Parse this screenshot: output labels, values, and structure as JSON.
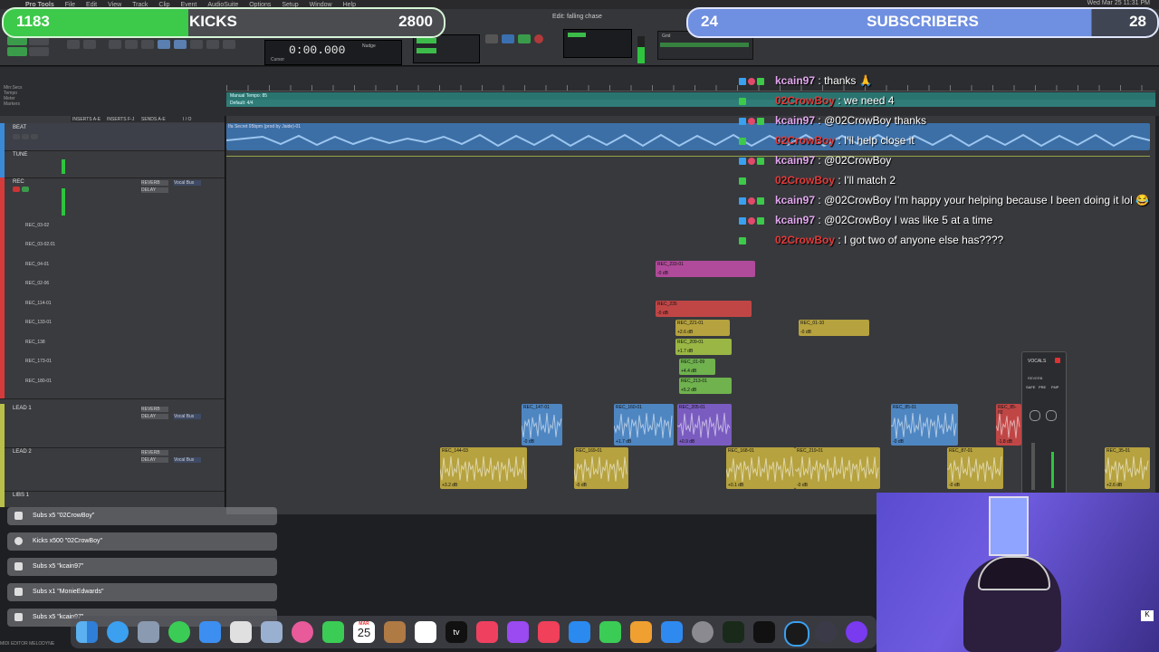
{
  "menubar": {
    "apple": "",
    "items": [
      "Pro Tools",
      "File",
      "Edit",
      "View",
      "Track",
      "Clip",
      "Event",
      "AudioSuite",
      "Options",
      "Setup",
      "Window",
      "Help"
    ],
    "clock": "Wed Mar 25  11:31 PM"
  },
  "overlay": {
    "kicks": {
      "left": "1183",
      "center": "KICKS",
      "right": "2800",
      "progress": 0.42
    },
    "subs": {
      "left": "24",
      "center": "SUBSCRIBERS",
      "right": "28",
      "progress": 0.86
    }
  },
  "toolbar": {
    "counter_main": "0:00.000",
    "edit_title": "Edit: falling chase",
    "cursor_label": "Cursor",
    "grid_label": "Grid",
    "nudge_label": "Nudge"
  },
  "ruler": {
    "labels": [
      "Min:Secs",
      "Tempo",
      "Meter",
      "Markers"
    ],
    "tempo_text": "Manual Tempo: 85",
    "meter_text": "Default: 4/4"
  },
  "track_headers": [
    "INSERTS A-E",
    "INSERTS F-J",
    "SENDS A-E",
    "I / O"
  ],
  "tracks": [
    {
      "name": "BEAT",
      "color": "#3b8ad6"
    },
    {
      "name": "TUNE",
      "color": "#3b8ad6"
    },
    {
      "name": "REC",
      "color": "#d63b3b"
    },
    {
      "name": "LEAD 1",
      "color": "#b8c04a"
    },
    {
      "name": "LEAD 2",
      "color": "#b8c04a"
    },
    {
      "name": "LIBS 1",
      "color": "#b8c04a"
    }
  ],
  "rec_subtracks": [
    "REC_03-02",
    "REC_03-02.01",
    "REC_04-01",
    "REC_02-06",
    "REC_114-01",
    "REC_133-01",
    "REC_138",
    "REC_173-01",
    "REC_180-01"
  ],
  "inserts": {
    "reverb": "REVERB",
    "delay": "DELAY",
    "vocal_bus": "Vocal Bus"
  },
  "clips": [
    {
      "name": "REC_233-01",
      "gain": "-0 dB",
      "color": "#b04a9a"
    },
    {
      "name": "REC_235",
      "gain": "-0 dB",
      "color": "#c04646"
    },
    {
      "name": "REC_221-01",
      "gain": "+2.6 dB",
      "color": "#b6a23e"
    },
    {
      "name": "REC_01-10",
      "gain": "-0 dB",
      "color": "#b6a23e"
    },
    {
      "name": "REC_209-01",
      "gain": "+1.7 dB",
      "color": "#9ab644"
    },
    {
      "name": "REC_01-09",
      "gain": "+4.4 dB",
      "color": "#6fb24e"
    },
    {
      "name": "REC_213-01",
      "gain": "+5.2 dB",
      "color": "#6fb24e"
    },
    {
      "name": "REC_147-01",
      "gain": "-0 dB",
      "color": "#4e86c2"
    },
    {
      "name": "REC_160-01",
      "gain": "+1.7 dB",
      "color": "#4e86c2"
    },
    {
      "name": "REC_205-01",
      "gain": "+0.9 dB",
      "color": "#7a5cc0"
    },
    {
      "name": "REC_85-01",
      "gain": "-0 dB",
      "color": "#4e86c2"
    },
    {
      "name": "REC_85-02",
      "gain": "-1.8 dB",
      "color": "#c04646"
    },
    {
      "name": "REC_144-03",
      "gain": "+3.2 dB",
      "color": "#b6a23e"
    },
    {
      "name": "REC_169-01",
      "gain": "-0 dB",
      "color": "#b6a23e"
    },
    {
      "name": "REC_168-01",
      "gain": "+0.1 dB",
      "color": "#b6a23e"
    },
    {
      "name": "REC_219-01",
      "gain": "-0 dB",
      "color": "#b6a23e"
    },
    {
      "name": "REC_87-01",
      "gain": "-0 dB",
      "color": "#b6a23e"
    },
    {
      "name": "REC_35-01",
      "gain": "+2.6 dB",
      "color": "#b6a23e"
    }
  ],
  "beat_clip_name": "Ifa Secret 95bpm (prod by Jaide)-01",
  "chat": [
    {
      "user": "kcain97",
      "user_color": "#e3a8f0",
      "badges": [
        "sub",
        "heart",
        "star"
      ],
      "msg": "thanks 🙏"
    },
    {
      "user": "02CrowBoy",
      "user_color": "#e23b3b",
      "badges": [
        "star"
      ],
      "msg": "we need 4"
    },
    {
      "user": "kcain97",
      "user_color": "#e3a8f0",
      "badges": [
        "sub",
        "heart",
        "star"
      ],
      "msg": "@02CrowBoy thanks"
    },
    {
      "user": "02CrowBoy",
      "user_color": "#e23b3b",
      "badges": [
        "star"
      ],
      "msg": "I'll help close it"
    },
    {
      "user": "kcain97",
      "user_color": "#e3a8f0",
      "badges": [
        "sub",
        "heart",
        "star"
      ],
      "msg": "@02CrowBoy"
    },
    {
      "user": "02CrowBoy",
      "user_color": "#e23b3b",
      "badges": [
        "star"
      ],
      "msg": "I'll match 2"
    },
    {
      "user": "kcain97",
      "user_color": "#e3a8f0",
      "badges": [
        "sub",
        "heart",
        "star"
      ],
      "msg": "@02CrowBoy I'm happy your helping because I been doing it lol 😂"
    },
    {
      "user": "kcain97",
      "user_color": "#e3a8f0",
      "badges": [
        "sub",
        "heart",
        "star"
      ],
      "msg": "@02CrowBoy I was like 5 at a time"
    },
    {
      "user": "02CrowBoy",
      "user_color": "#e23b3b",
      "badges": [
        "star"
      ],
      "msg": "I got two of anyone else has????"
    }
  ],
  "alerts": [
    "Subs x5 \"02CrowBoy\"",
    "Kicks x500 \"02CrowBoy\"",
    "Subs x5 \"kcain97\"",
    "Subs x1 \"MonieEdwards\"",
    "Subs x5 \"kcain97\""
  ],
  "mini_mixer": {
    "title": "VOCALS",
    "labels": [
      "SAFE",
      "PRE",
      "FMP"
    ],
    "reverb": "REVERB"
  },
  "dock": {
    "calendar_month": "MAR",
    "calendar_day": "25",
    "icons": [
      "finder-icon",
      "safari-icon",
      "launchpad-icon",
      "messages-icon",
      "mail-icon",
      "notes-folder-icon",
      "photos-icon",
      "facetime-icon",
      "calendar-icon",
      "contacts-icon",
      "reminders-icon",
      "appletv-icon",
      "music-icon",
      "podcasts-icon",
      "news-icon",
      "keynote-icon",
      "numbers-icon",
      "pages-icon",
      "appstore-icon",
      "settings-icon",
      "protools-icon",
      "ilok-icon",
      "obs-icon",
      "utility-icon",
      "app-icon"
    ],
    "tv_label": "tv"
  },
  "bottom_status": "MIDI EDITOR   MELODYNE"
}
